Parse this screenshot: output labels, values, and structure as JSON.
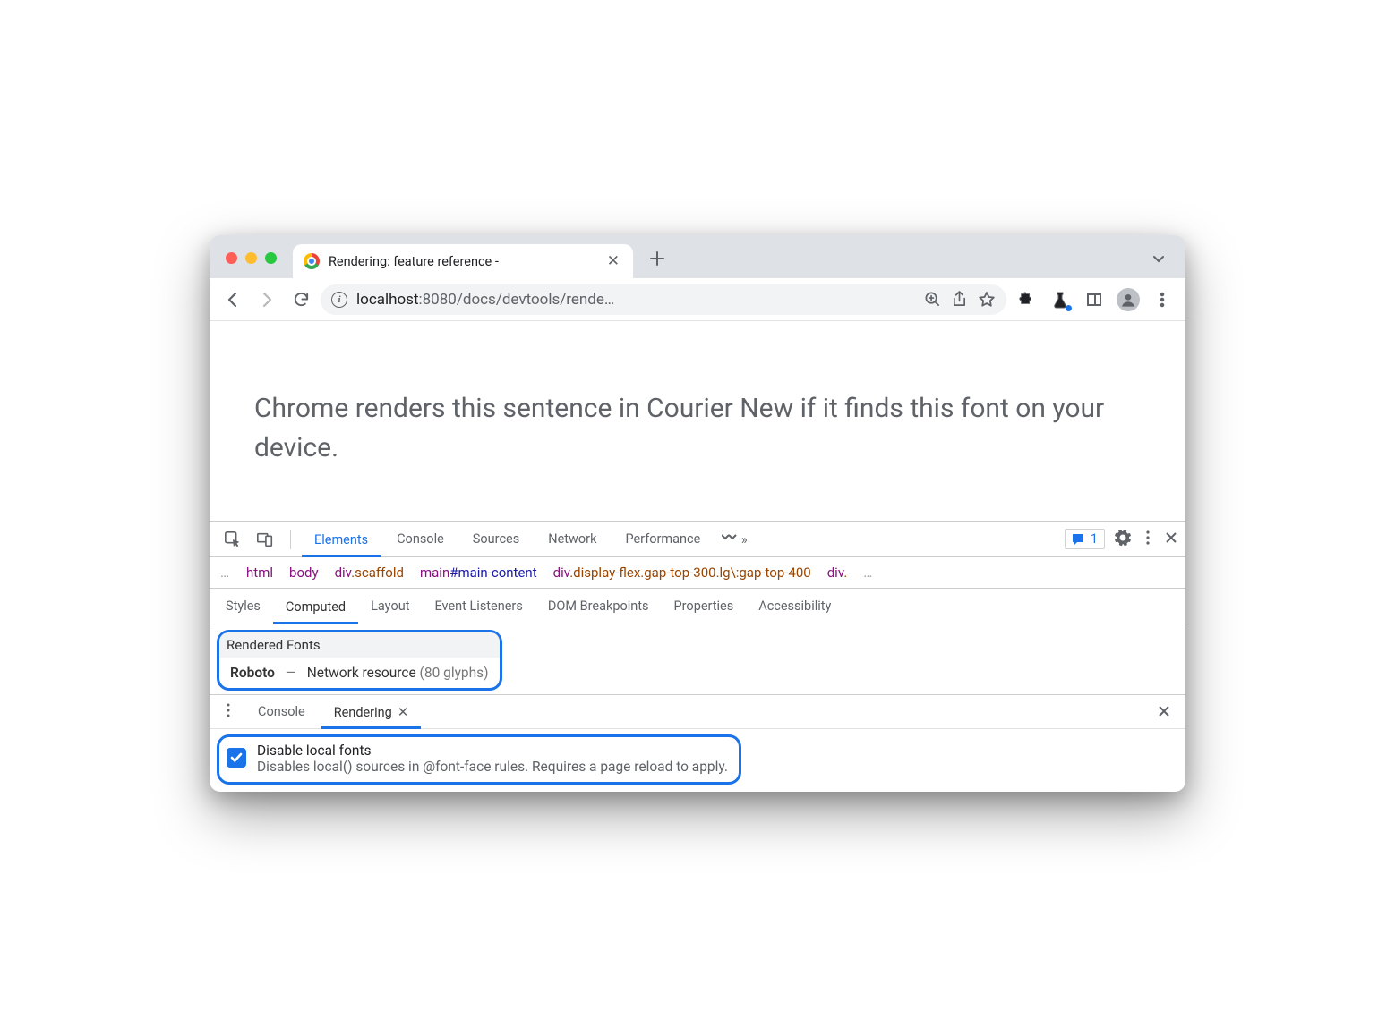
{
  "tabstrip": {
    "title": "Rendering: feature reference -"
  },
  "toolbar": {
    "url_host": "localhost",
    "url_port": ":8080",
    "url_path": "/docs/devtools/rende…"
  },
  "viewport": {
    "sentence": "Chrome renders this sentence in Courier New if it finds this font on your device."
  },
  "devtools": {
    "tabs": [
      "Elements",
      "Console",
      "Sources",
      "Network",
      "Performance"
    ],
    "active_tab": 0,
    "issue_count": "1",
    "breadcrumb": [
      {
        "tag": "html"
      },
      {
        "tag": "body"
      },
      {
        "tag": "div",
        "cls": ".scaffold"
      },
      {
        "tag": "main",
        "id": "#main-content"
      },
      {
        "tag": "div",
        "cls": ".display-flex.gap-top-300.lg\\:gap-top-400"
      },
      {
        "tag": "div",
        "cls": "."
      }
    ],
    "side_tabs": [
      "Styles",
      "Computed",
      "Layout",
      "Event Listeners",
      "DOM Breakpoints",
      "Properties",
      "Accessibility"
    ],
    "side_active": 1,
    "rendered_fonts": {
      "heading": "Rendered Fonts",
      "family": "Roboto",
      "source": "Network resource",
      "glyphs": "(80 glyphs)"
    },
    "drawer_tabs": [
      "Console",
      "Rendering"
    ],
    "drawer_active": 1,
    "option": {
      "title": "Disable local fonts",
      "desc": "Disables local() sources in @font-face rules. Requires a page reload to apply.",
      "checked": true
    }
  }
}
